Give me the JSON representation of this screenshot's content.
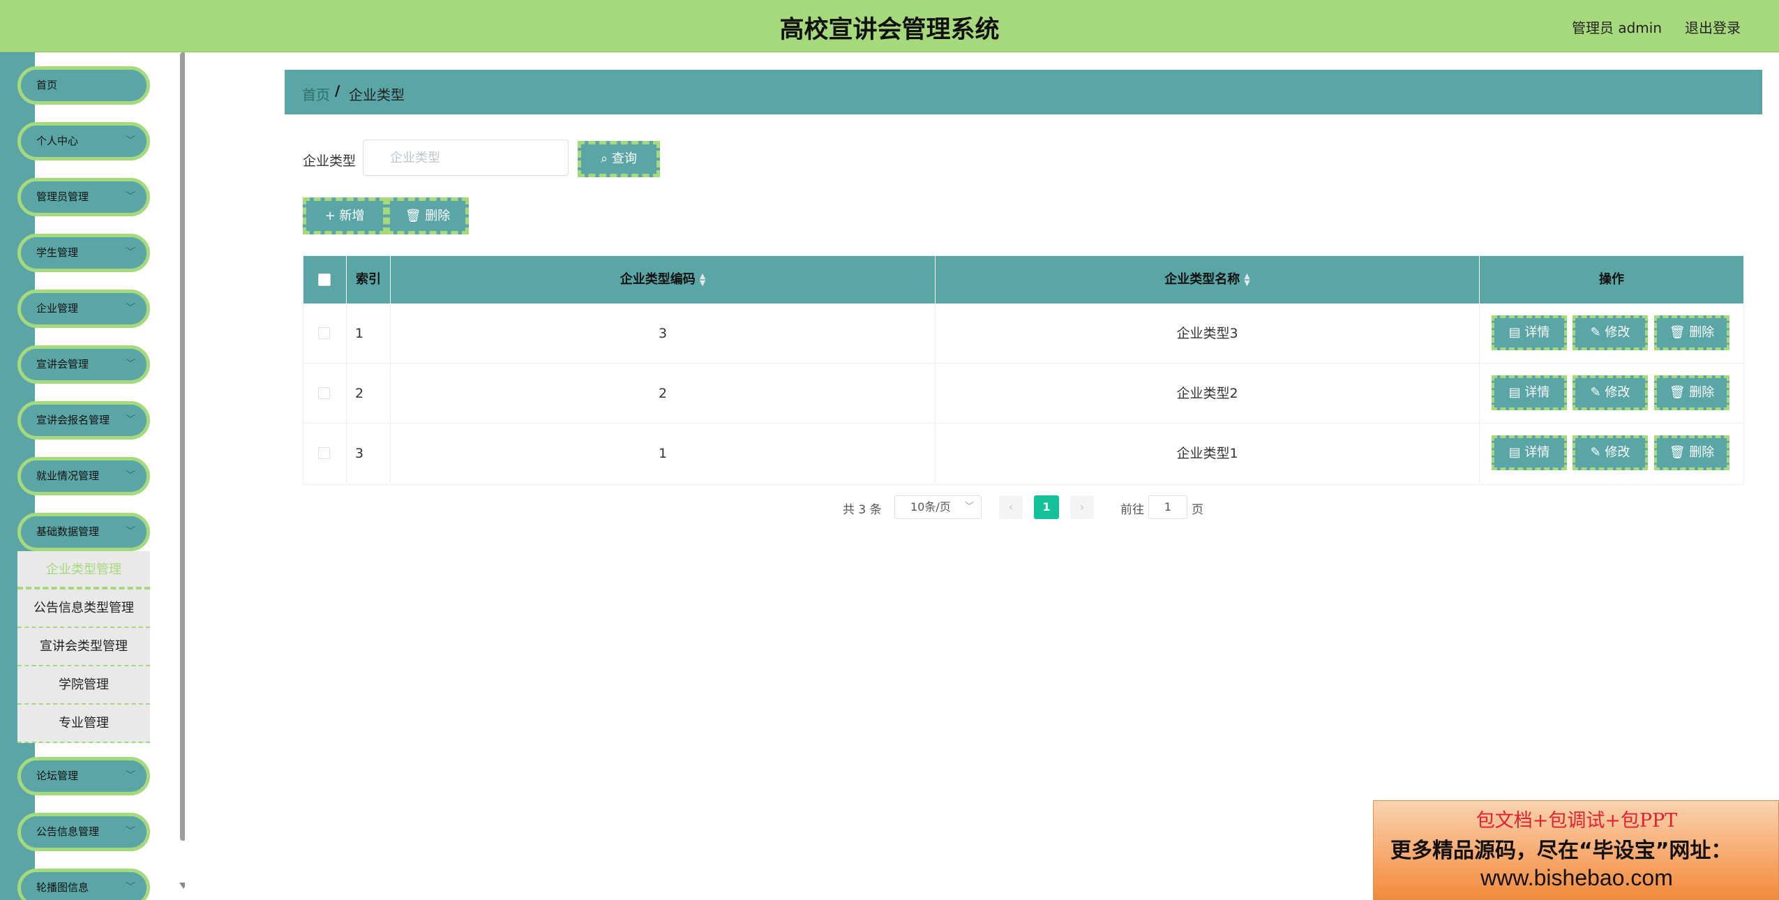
{
  "header": {
    "title": "高校宣讲会管理系统",
    "user": "管理员 admin",
    "logout": "退出登录"
  },
  "sidebar": {
    "items": [
      {
        "label": "首页",
        "has_chevron": false
      },
      {
        "label": "个人中心",
        "has_chevron": true
      },
      {
        "label": "管理员管理",
        "has_chevron": true
      },
      {
        "label": "学生管理",
        "has_chevron": true
      },
      {
        "label": "企业管理",
        "has_chevron": true
      },
      {
        "label": "宣讲会管理",
        "has_chevron": true
      },
      {
        "label": "宣讲会报名管理",
        "has_chevron": true
      },
      {
        "label": "就业情况管理",
        "has_chevron": true
      },
      {
        "label": "基础数据管理",
        "has_chevron": true
      },
      {
        "label": "论坛管理",
        "has_chevron": true
      },
      {
        "label": "公告信息管理",
        "has_chevron": true
      },
      {
        "label": "轮播图信息",
        "has_chevron": true
      }
    ],
    "submenu": [
      {
        "label": "企业类型管理",
        "active": true
      },
      {
        "label": "公告信息类型管理",
        "active": false
      },
      {
        "label": "宣讲会类型管理",
        "active": false
      },
      {
        "label": "学院管理",
        "active": false
      },
      {
        "label": "专业管理",
        "active": false
      }
    ]
  },
  "breadcrumb": {
    "home": "首页",
    "separator": "/",
    "current": "企业类型"
  },
  "search": {
    "label": "企业类型",
    "placeholder": "企业类型",
    "query_label": "查询"
  },
  "toolbar": {
    "add_label": "新增",
    "delete_label": "删除"
  },
  "table": {
    "columns": {
      "index": "索引",
      "code": "企业类型编码",
      "name": "企业类型名称",
      "ops": "操作"
    },
    "rows": [
      {
        "index": "1",
        "code": "3",
        "name": "企业类型3"
      },
      {
        "index": "2",
        "code": "2",
        "name": "企业类型2"
      },
      {
        "index": "3",
        "code": "1",
        "name": "企业类型1"
      }
    ],
    "actions": {
      "detail": "详情",
      "edit": "修改",
      "delete": "删除"
    }
  },
  "pagination": {
    "total": "共 3 条",
    "page_size": "10条/页",
    "current_page": "1",
    "goto_label": "前往",
    "goto_value": "1",
    "page_unit": "页"
  },
  "ad": {
    "line1": "包文档+包调试+包PPT",
    "line2": "更多精品源码，尽在“毕设宝”网址：",
    "line3": "www.bishebao.com"
  },
  "colors": {
    "header": "#a6d97b",
    "teal": "#5aa6a6",
    "page_active": "#13c29b"
  }
}
